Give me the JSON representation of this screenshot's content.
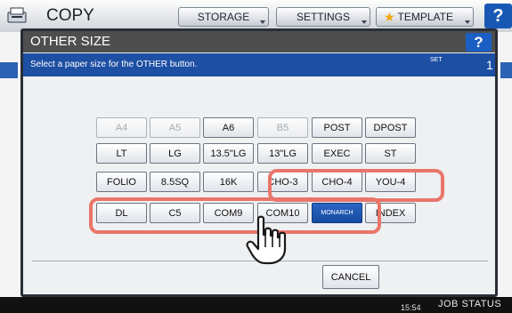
{
  "topbar": {
    "copy_title": "COPY",
    "storage": "STORAGE",
    "settings": "SETTINGS",
    "template": "TEMPLATE",
    "help": "?"
  },
  "dialog": {
    "title": "OTHER SIZE",
    "help": "?",
    "instruction": "Select a paper size for the OTHER button.",
    "set_label": "SET",
    "set_count": "1",
    "cancel": "CANCEL"
  },
  "sizes": [
    {
      "label": "A4",
      "enabled": false
    },
    {
      "label": "A5",
      "enabled": false
    },
    {
      "label": "A6",
      "enabled": true
    },
    {
      "label": "B5",
      "enabled": false
    },
    {
      "label": "POST",
      "enabled": true
    },
    {
      "label": "DPOST",
      "enabled": true
    },
    {
      "label": "LT",
      "enabled": true
    },
    {
      "label": "LG",
      "enabled": true
    },
    {
      "label": "13.5\"LG",
      "enabled": true
    },
    {
      "label": "13\"LG",
      "enabled": true
    },
    {
      "label": "EXEC",
      "enabled": true
    },
    {
      "label": "ST",
      "enabled": true
    },
    {
      "label": "FOLIO",
      "enabled": true
    },
    {
      "label": "8.5SQ",
      "enabled": true
    },
    {
      "label": "16K",
      "enabled": true
    },
    {
      "label": "CHO-3",
      "enabled": true
    },
    {
      "label": "CHO-4",
      "enabled": true
    },
    {
      "label": "YOU-4",
      "enabled": true
    },
    {
      "label": "DL",
      "enabled": true
    },
    {
      "label": "C5",
      "enabled": true
    },
    {
      "label": "COM9",
      "enabled": true
    },
    {
      "label": "COM10",
      "enabled": true
    },
    {
      "label": "MONARCH",
      "enabled": true,
      "selected": true
    },
    {
      "label": "INDEX",
      "enabled": true
    }
  ],
  "statusbar": {
    "clock": "15:54",
    "job_status": "JOB STATUS"
  },
  "colors": {
    "highlight": "#e9756a",
    "info_bar": "#1d4fa3",
    "selected_key": "#1f58b5"
  },
  "icons": [
    "copy-icon",
    "star-icon",
    "dropdown-arrow-icon",
    "help-icon",
    "hand-pointer-icon"
  ]
}
